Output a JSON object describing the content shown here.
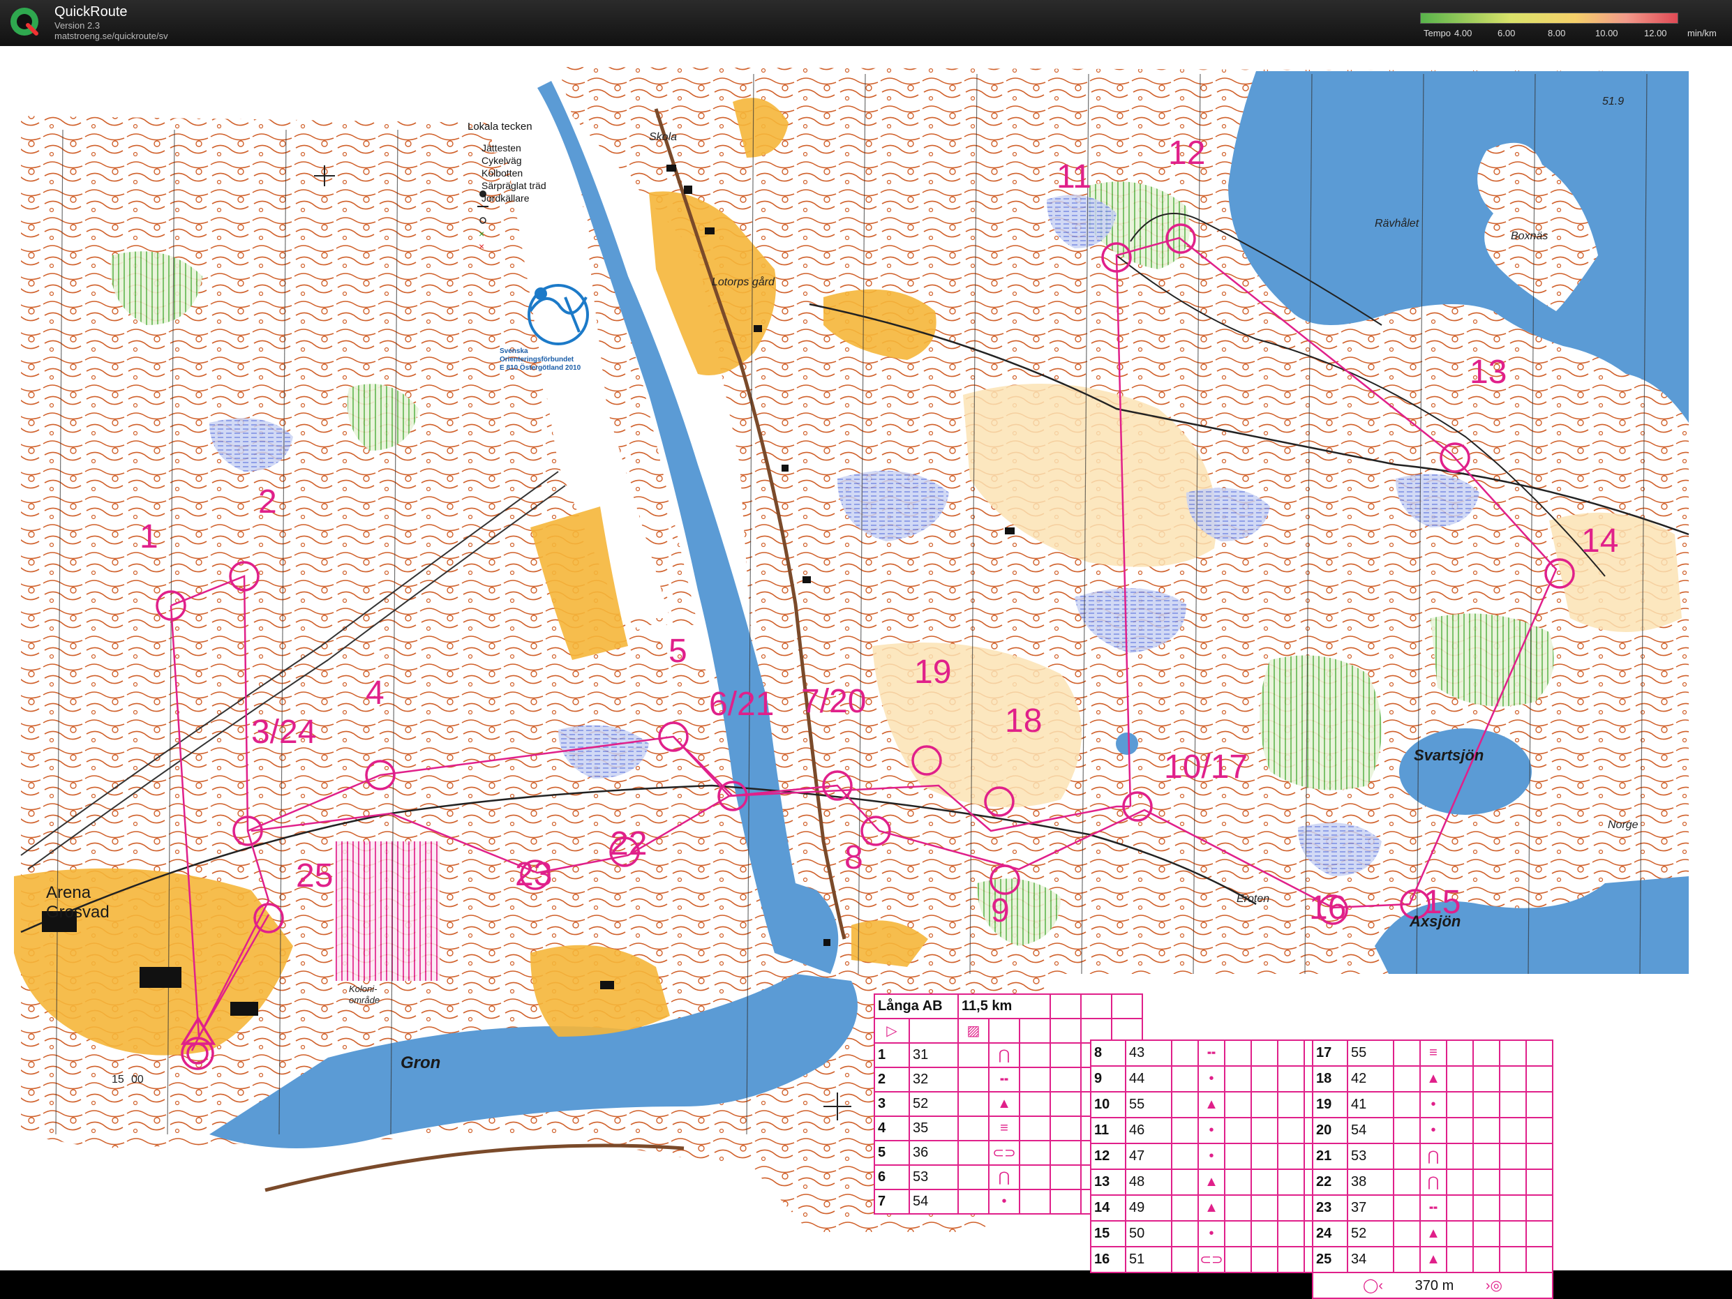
{
  "app": {
    "name": "QuickRoute",
    "version": "Version 2.3",
    "url": "matstroeng.se/quickroute/sv",
    "tempo_label": "Tempo",
    "tempo_ticks": [
      "4.00",
      "6.00",
      "8.00",
      "10.00",
      "12.00"
    ],
    "tempo_unit": "min/km"
  },
  "legend": {
    "title": "Lokala tecken",
    "items": [
      "Jättesten",
      "Cykelväg",
      "Kolbotten",
      "Särpräglat träd",
      "Jordkällare"
    ]
  },
  "club": {
    "line1": "Svenska",
    "line2": "Orienteringsförbundet",
    "line3": "E 810 Östergötland 2010"
  },
  "places": {
    "skola": "Skola",
    "lotorps_gard": "Lotorps gård",
    "ravhalet": "Rävhålet",
    "boxnas": "Boxnäs",
    "svartsjon": "Svartsjön",
    "axsjon": "Axsjön",
    "norge": "Norge",
    "eroten": "Eroten",
    "arena": "Arena",
    "grosvad": "Grosvad",
    "gron": "Gron",
    "koloni1": "Koloni-",
    "koloni2": "område",
    "map_number": "51.9",
    "map_number2": "15",
    "map_number3": "00"
  },
  "controls": {
    "c1": "1",
    "c2": "2",
    "c3": "3/24",
    "c4": "4",
    "c5": "5",
    "c6": "6/21",
    "c7": "7/20",
    "c8": "8",
    "c9": "9",
    "c10": "10/17",
    "c11": "11",
    "c12": "12",
    "c13": "13",
    "c14": "14",
    "c15": "15",
    "c16": "16",
    "c18": "18",
    "c19": "19",
    "c22": "22",
    "c23": "23",
    "c25": "25"
  },
  "course": {
    "name": "Långa AB",
    "length": "11,5 km",
    "finish_distance": "370 m",
    "rows_a": [
      [
        "1",
        "31"
      ],
      [
        "2",
        "32"
      ],
      [
        "3",
        "52"
      ],
      [
        "4",
        "35"
      ],
      [
        "5",
        "36"
      ],
      [
        "6",
        "53"
      ],
      [
        "7",
        "54"
      ]
    ],
    "rows_b": [
      [
        "8",
        "43"
      ],
      [
        "9",
        "44"
      ],
      [
        "10",
        "55"
      ],
      [
        "11",
        "46"
      ],
      [
        "12",
        "47"
      ],
      [
        "13",
        "48"
      ],
      [
        "14",
        "49"
      ],
      [
        "15",
        "50"
      ],
      [
        "16",
        "51"
      ]
    ],
    "rows_c": [
      [
        "17",
        "55"
      ],
      [
        "18",
        "42"
      ],
      [
        "19",
        "41"
      ],
      [
        "20",
        "54"
      ],
      [
        "21",
        "53"
      ],
      [
        "22",
        "38"
      ],
      [
        "23",
        "37"
      ],
      [
        "24",
        "52"
      ],
      [
        "25",
        "34"
      ]
    ]
  },
  "colors": {
    "course": "#e0208a",
    "forest_white": "#ffffff",
    "open": "#f5b63a",
    "water": "#5b9bd5",
    "marsh": "#7f8fdf",
    "contour": "#c8541b",
    "green": "#7dbf6a"
  }
}
